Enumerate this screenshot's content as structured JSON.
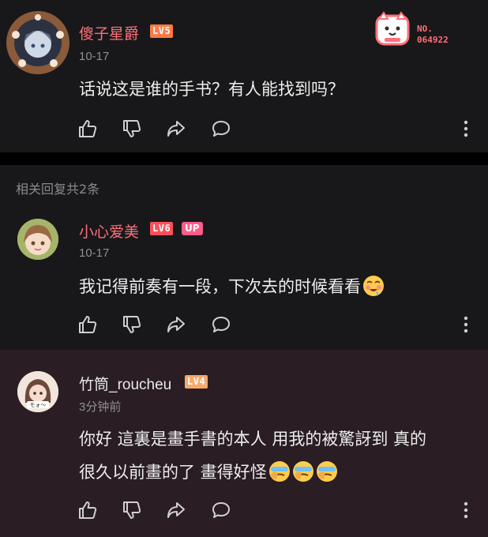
{
  "main_comment": {
    "username": "傻子星爵",
    "level": "LV5",
    "level_color": "#ff7a45",
    "name_color": "#ff6f78",
    "time": "10-17",
    "text": "话说这是谁的手书？有人能找到吗？",
    "badge": {
      "icon": "cat-fan-badge-icon",
      "label": "NO.",
      "number": "064922"
    }
  },
  "replies_header": "相关回复共2条",
  "replies": [
    {
      "username": "小心爱美",
      "level": "LV6",
      "level_color": "#ff4f5b",
      "name_color": "#ff6f78",
      "up_tag": "UP",
      "time": "10-17",
      "text": "我记得前奏有一段，下次去的时候看看",
      "emoji": "drooling-face-icon"
    },
    {
      "username": "竹筒_roucheu",
      "level": "LV4",
      "level_color": "#f6a96b",
      "name_color": "#e9e9e9",
      "time": "3分钟前",
      "text_line1": "你好 這裏是畫手書的本人 用我的被驚訝到 真的",
      "text_line2": "很久以前畫的了  畫得好怪",
      "emoji": "facepalm-face-icon"
    }
  ]
}
